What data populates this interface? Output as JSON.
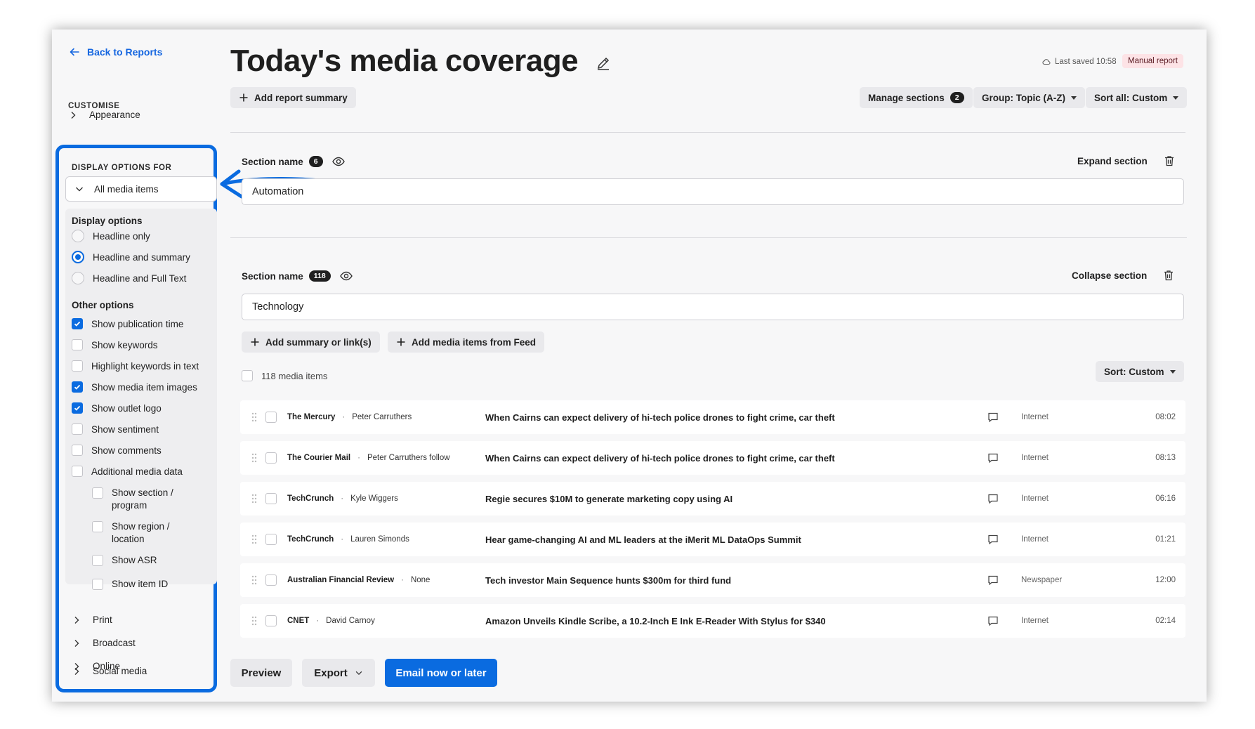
{
  "sidebar": {
    "back_label": "Back to Reports",
    "customise_label": "CUSTOMISE",
    "appearance_label": "Appearance",
    "display_options_for_label": "DISPLAY OPTIONS FOR",
    "selected_scope": "All media items",
    "display_options_heading": "Display options",
    "display_options": [
      {
        "label": "Headline only",
        "selected": false
      },
      {
        "label": "Headline and summary",
        "selected": true
      },
      {
        "label": "Headline and Full Text",
        "selected": false
      }
    ],
    "other_options_heading": "Other options",
    "other_options": [
      {
        "label": "Show publication time",
        "checked": true
      },
      {
        "label": "Show keywords",
        "checked": false
      },
      {
        "label": "Highlight keywords in text",
        "checked": false
      },
      {
        "label": "Show media item images",
        "checked": true
      },
      {
        "label": "Show outlet logo",
        "checked": true
      },
      {
        "label": "Show sentiment",
        "checked": false
      },
      {
        "label": "Show comments",
        "checked": false
      },
      {
        "label": "Additional media data",
        "checked": false
      }
    ],
    "additional_options": [
      {
        "label": "Show section / program",
        "checked": false
      },
      {
        "label": "Show region / location",
        "checked": false
      },
      {
        "label": "Show ASR",
        "checked": false
      },
      {
        "label": "Show item ID",
        "checked": false
      }
    ],
    "sections": [
      "Print",
      "Broadcast",
      "Online",
      "Social media"
    ]
  },
  "header": {
    "title": "Today's media coverage",
    "last_saved": "Last saved 10:58",
    "report_type": "Manual report"
  },
  "toolbar": {
    "add_summary": "Add report summary",
    "manage_sections": "Manage sections",
    "manage_sections_count": "2",
    "group": "Group: Topic (A-Z)",
    "sort_all": "Sort all: Custom"
  },
  "sections": [
    {
      "label": "Section name",
      "count": "6",
      "action": "Expand section",
      "value": "Automation"
    },
    {
      "label": "Section name",
      "count": "118",
      "action": "Collapse section",
      "value": "Technology"
    }
  ],
  "section_actions": {
    "add_summary": "Add summary or link(s)",
    "add_media": "Add media items from Feed",
    "items_count": "118 media items",
    "sort": "Sort: Custom"
  },
  "media_items": [
    {
      "outlet": "The Mercury",
      "author": "Peter Carruthers",
      "headline": "When Cairns can expect delivery of hi-tech police drones to fight crime, car theft",
      "type": "Internet",
      "time": "08:02"
    },
    {
      "outlet": "The Courier Mail",
      "author": "Peter Carruthers follow",
      "headline": "When Cairns can expect delivery of hi-tech police drones to fight crime, car theft",
      "type": "Internet",
      "time": "08:13"
    },
    {
      "outlet": "TechCrunch",
      "author": "Kyle Wiggers",
      "headline": "Regie secures $10M to generate marketing copy using AI",
      "type": "Internet",
      "time": "06:16"
    },
    {
      "outlet": "TechCrunch",
      "author": "Lauren Simonds",
      "headline": "Hear game-changing AI and ML leaders at the iMerit ML DataOps Summit",
      "type": "Internet",
      "time": "01:21"
    },
    {
      "outlet": "Australian Financial Review",
      "author": "None",
      "headline": "Tech investor Main Sequence hunts $300m for third fund",
      "type": "Newspaper",
      "time": "12:00"
    },
    {
      "outlet": "CNET",
      "author": "David Carnoy",
      "headline": "Amazon Unveils Kindle Scribe, a 10.2-Inch E Ink E-Reader With Stylus for $340",
      "type": "Internet",
      "time": "02:14"
    }
  ],
  "footer": {
    "preview": "Preview",
    "export": "Export",
    "email": "Email now or later"
  },
  "colors": {
    "accent": "#0a6be0",
    "badge_bg": "#fde3e6"
  }
}
